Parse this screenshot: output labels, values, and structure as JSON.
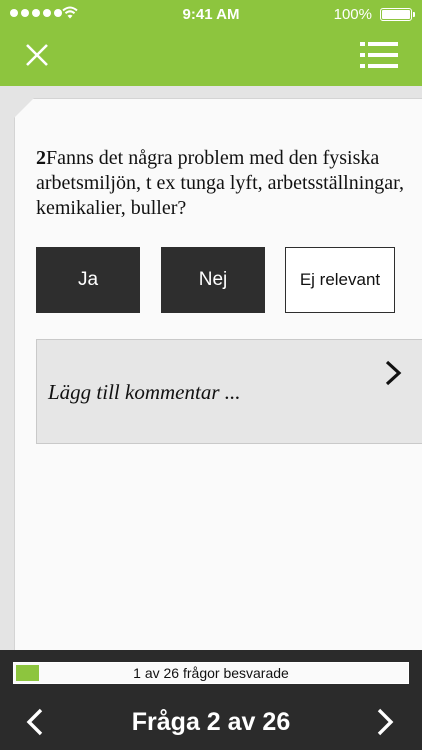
{
  "status_bar": {
    "time": "9:41 AM",
    "battery_percent": "100%",
    "signal_icon": "signal-dots-icon",
    "wifi_icon": "wifi-icon",
    "battery_icon": "battery-icon"
  },
  "header": {
    "close_icon": "close-icon",
    "menu_icon": "list-menu-icon",
    "accent_color": "#8dc53e"
  },
  "question": {
    "number": "2",
    "text": "Fanns det några problem med den fysiska arbetsmiljön, t ex tunga lyft, arbetsställningar, kemikalier, buller?"
  },
  "answers": [
    {
      "label": "Ja"
    },
    {
      "label": "Nej"
    },
    {
      "label": "Ej relevant"
    }
  ],
  "comment": {
    "placeholder": "Lägg till kommentar ...",
    "chevron_icon": "chevron-right-icon"
  },
  "footer": {
    "progress_label": "1 av 26 frågor besvarade",
    "answered": 1,
    "total": 26,
    "nav_title": "Fråga 2 av 26",
    "prev_icon": "chevron-left-icon",
    "next_icon": "chevron-right-icon"
  }
}
